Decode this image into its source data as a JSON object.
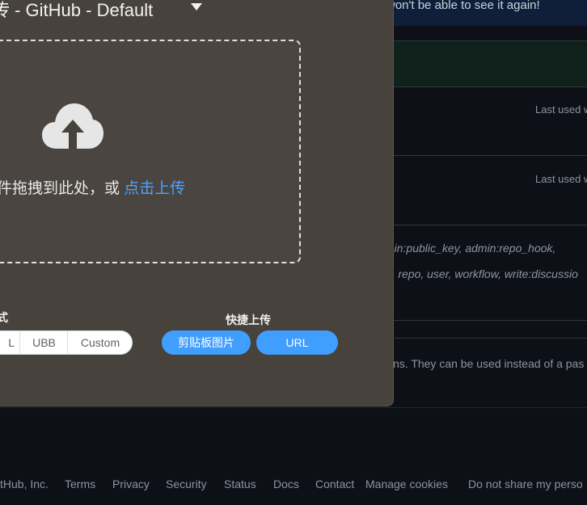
{
  "background": {
    "banner_text": "won't be able to see it again!",
    "tokens": [
      {
        "last_used": "Last used w"
      },
      {
        "last_used": "Last used w"
      }
    ],
    "scopes_line1": "min:public_key, admin:repo_hook,",
    "scopes_line2": "rt, repo, user, workflow, write:discussio",
    "description": "ns. They can be used instead of a pas",
    "footer": {
      "copyright": "tHub, Inc.",
      "links": [
        "Terms",
        "Privacy",
        "Security",
        "Status",
        "Docs",
        "Contact",
        "Manage cookies",
        "Do not share my perso"
      ]
    }
  },
  "dialog": {
    "title": "传 - GitHub - Default",
    "drop_text": "拖拽到此处，或 ",
    "drop_text_prefix": "件",
    "upload_link": "点击上传",
    "format_label": "式",
    "format_options": [
      "L",
      "UBB",
      "Custom"
    ],
    "quick_upload_label": "快捷上传",
    "clipboard_button": "剪贴板图片",
    "url_button": "URL"
  },
  "colors": {
    "dialog_bg": "#47423c",
    "accent": "#409eff",
    "page_bg": "#0d1117"
  }
}
